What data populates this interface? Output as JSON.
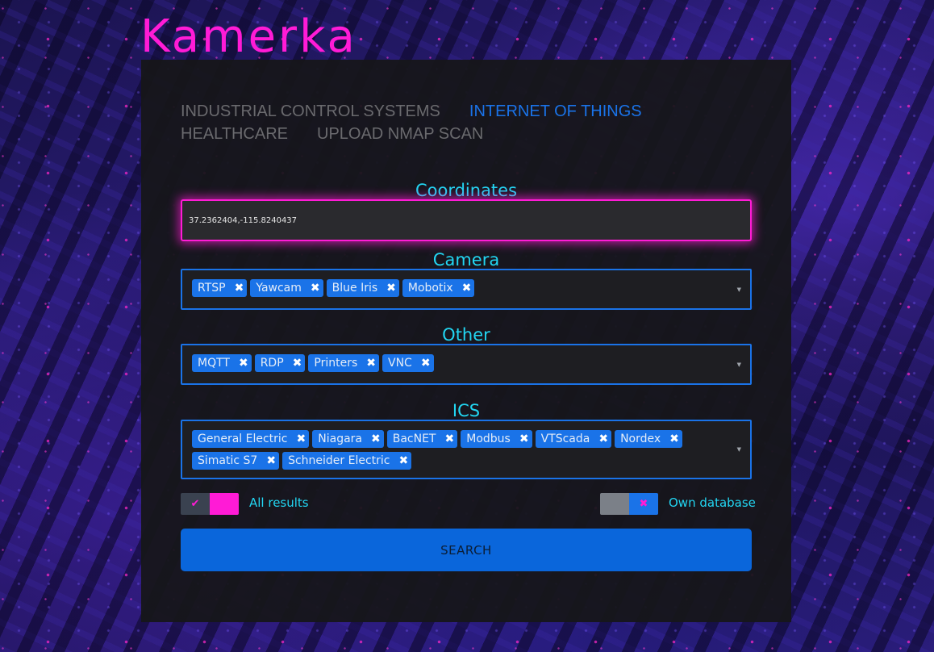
{
  "app": {
    "logo": "Kamerka"
  },
  "nav": {
    "tabs": [
      {
        "label": "INDUSTRIAL CONTROL SYSTEMS",
        "active": false
      },
      {
        "label": "INTERNET OF THINGS",
        "active": true
      },
      {
        "label": "HEALTHCARE",
        "active": false
      },
      {
        "label": "UPLOAD NMAP SCAN",
        "active": false
      }
    ]
  },
  "coordinates": {
    "label": "Coordinates",
    "value": "37.2362404,-115.8240437"
  },
  "camera": {
    "label": "Camera",
    "tags": [
      "RTSP",
      "Yawcam",
      "Blue Iris",
      "Mobotix"
    ]
  },
  "other": {
    "label": "Other",
    "tags": [
      "MQTT",
      "RDP",
      "Printers",
      "VNC"
    ]
  },
  "ics": {
    "label": "ICS",
    "tags": [
      "General Electric",
      "Niagara",
      "BacNET",
      "Modbus",
      "VTScada",
      "Nordex",
      "Simatic S7",
      "Schneider Electric"
    ]
  },
  "toggles": {
    "all_results": {
      "label": "All results",
      "on": true
    },
    "own_database": {
      "label": "Own database",
      "on": false
    }
  },
  "search": {
    "label": "SEARCH"
  },
  "colors": {
    "accent_pink": "#ff1bd6",
    "accent_cyan": "#22d6f2",
    "accent_blue": "#1a73e8"
  }
}
